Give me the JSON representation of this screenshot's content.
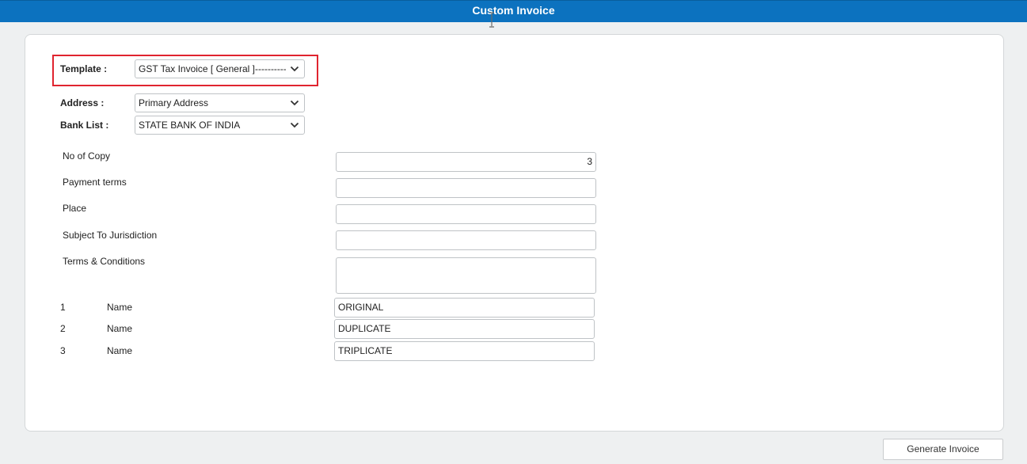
{
  "app": {
    "title": "Custom Invoice"
  },
  "template": {
    "label": "Template :",
    "value": "GST Tax Invoice [ General ]--------------"
  },
  "address": {
    "label": "Address :",
    "value": "Primary Address"
  },
  "bank_list": {
    "label": "Bank List :",
    "value": "STATE BANK OF INDIA"
  },
  "fields": {
    "no_of_copy": {
      "label": "No of Copy",
      "value": "3"
    },
    "payment_terms": {
      "label": "Payment terms",
      "value": ""
    },
    "place": {
      "label": "Place",
      "value": ""
    },
    "subject_to_jurisdiction": {
      "label": "Subject To Jurisdiction",
      "value": ""
    },
    "terms_conditions": {
      "label": "Terms & Conditions",
      "value": ""
    }
  },
  "copies": [
    {
      "number": "1",
      "label": "Name",
      "value": "ORIGINAL"
    },
    {
      "number": "2",
      "label": "Name",
      "value": "DUPLICATE"
    },
    {
      "number": "3",
      "label": "Name",
      "value": "TRIPLICATE"
    }
  ],
  "actions": {
    "generate_label": "Generate Invoice"
  },
  "colors": {
    "header_bg": "#0c72bf",
    "highlight": "#e0242f"
  },
  "icons": {
    "dropdown": "chevron-down-icon",
    "cursor": "text-cursor-icon"
  }
}
